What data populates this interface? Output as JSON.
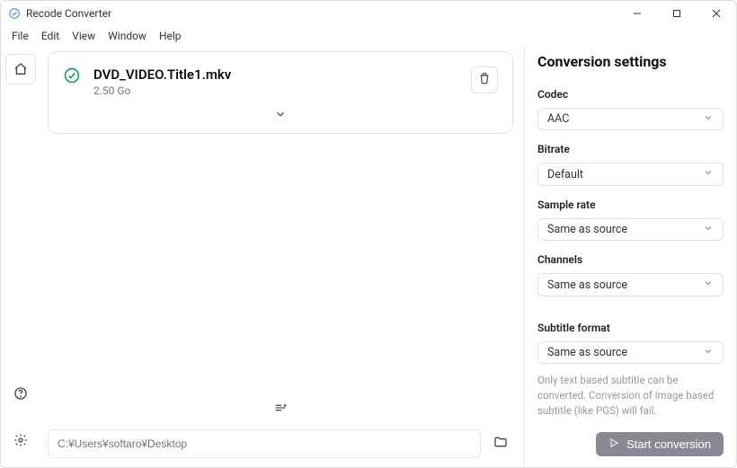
{
  "window": {
    "title": "Recode Converter"
  },
  "menubar": {
    "file": "File",
    "edit": "Edit",
    "view": "View",
    "window": "Window",
    "help": "Help"
  },
  "file": {
    "name": "DVD_VIDEO.Title1.mkv",
    "size": "2.50 Go"
  },
  "output": {
    "path_placeholder": "C:¥Users¥softaro¥Desktop"
  },
  "settings": {
    "title": "Conversion settings",
    "codec_label": "Codec",
    "codec_value": "AAC",
    "bitrate_label": "Bitrate",
    "bitrate_value": "Default",
    "samplerate_label": "Sample rate",
    "samplerate_value": "Same as source",
    "channels_label": "Channels",
    "channels_value": "Same as source",
    "subtitle_label": "Subtitle format",
    "subtitle_value": "Same as source",
    "subtitle_helper": "Only text based subtitle can be converted. Conversion of image based subtitle (like PGS) will fail.",
    "start_label": "Start conversion"
  }
}
